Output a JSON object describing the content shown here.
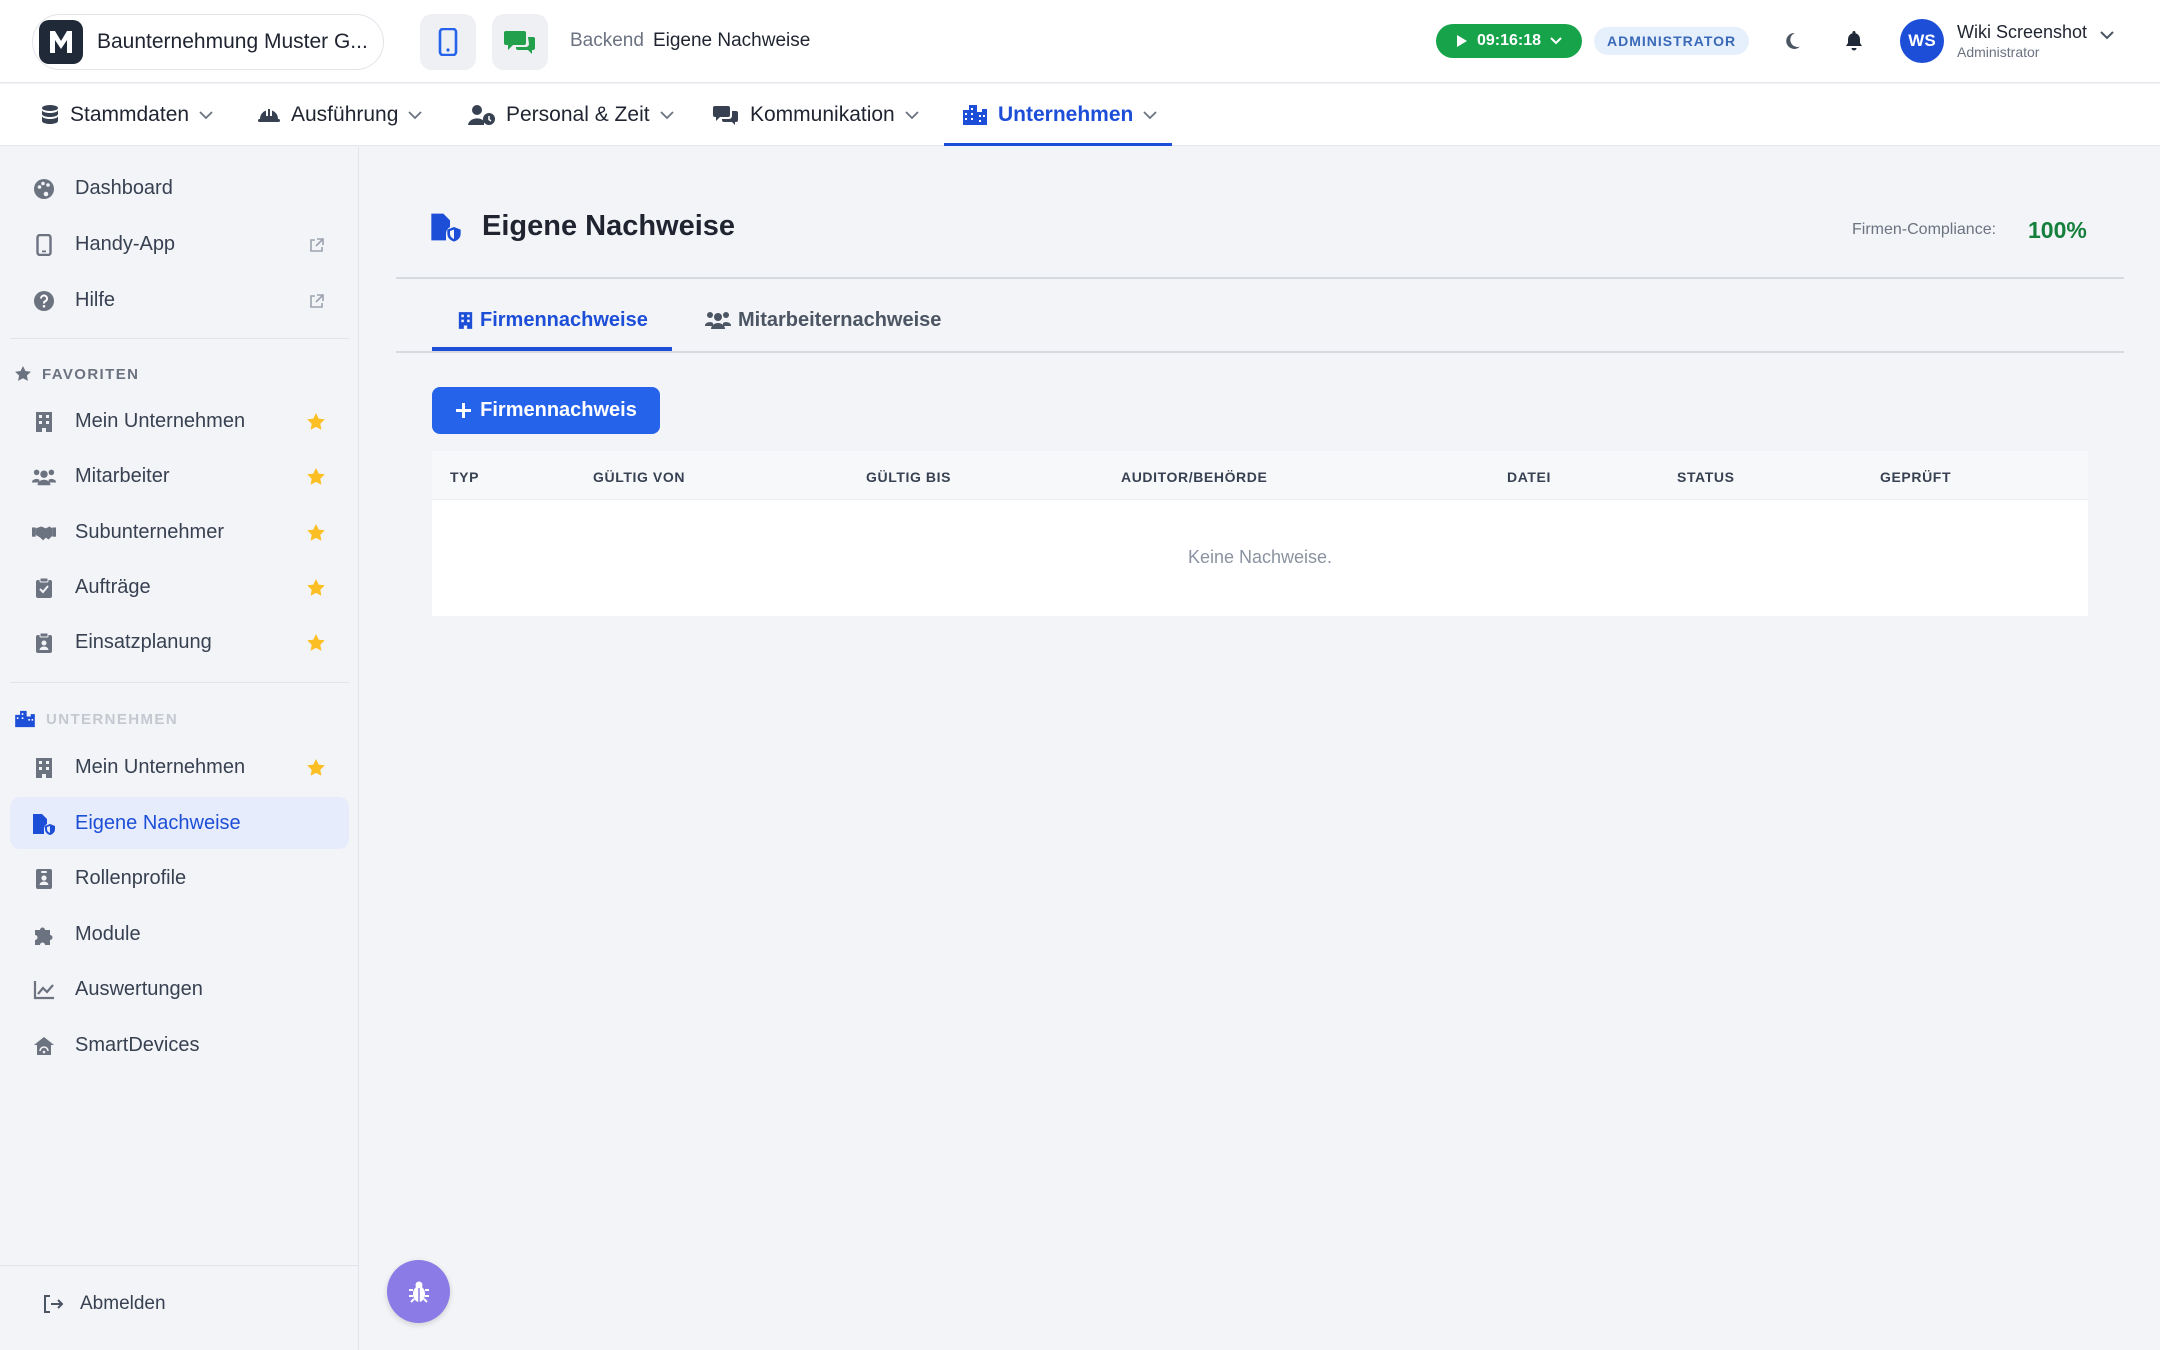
{
  "header": {
    "company_name": "Baunternehmung Muster G...",
    "logo_letter": "M",
    "breadcrumb": {
      "section": "Backend",
      "current": "Eigene Nachweise"
    },
    "timer": "09:16:18",
    "role_badge": "ADMINISTRATOR",
    "user": {
      "initials": "WS",
      "name": "Wiki Screenshot",
      "role": "Administrator"
    }
  },
  "mainnav": {
    "items": [
      {
        "label": "Stammdaten",
        "icon": "database-icon"
      },
      {
        "label": "Ausführung",
        "icon": "hardhat-icon"
      },
      {
        "label": "Personal & Zeit",
        "icon": "user-clock-icon"
      },
      {
        "label": "Kommunikation",
        "icon": "comments-icon"
      },
      {
        "label": "Unternehmen",
        "icon": "city-icon",
        "active": true
      }
    ]
  },
  "sidebar": {
    "top": [
      {
        "label": "Dashboard",
        "icon": "palette-icon"
      },
      {
        "label": "Handy-App",
        "icon": "mobile-icon",
        "external": true
      },
      {
        "label": "Hilfe",
        "icon": "question-circle-icon",
        "external": true
      }
    ],
    "favorites_title": "FAVORITEN",
    "favorites": [
      {
        "label": "Mein Unternehmen",
        "icon": "building-icon"
      },
      {
        "label": "Mitarbeiter",
        "icon": "users-icon"
      },
      {
        "label": "Subunternehmer",
        "icon": "handshake-icon"
      },
      {
        "label": "Aufträge",
        "icon": "clipboard-check-icon"
      },
      {
        "label": "Einsatzplanung",
        "icon": "clipboard-user-icon"
      }
    ],
    "company_title": "UNTERNEHMEN",
    "company": [
      {
        "label": "Mein Unternehmen",
        "icon": "building-icon",
        "starred": true
      },
      {
        "label": "Eigene Nachweise",
        "icon": "file-shield-icon",
        "active": true
      },
      {
        "label": "Rollenprofile",
        "icon": "id-badge-icon"
      },
      {
        "label": "Module",
        "icon": "puzzle-icon"
      },
      {
        "label": "Auswertungen",
        "icon": "chart-line-icon"
      },
      {
        "label": "SmartDevices",
        "icon": "smart-home-icon"
      }
    ],
    "logout": "Abmelden"
  },
  "page": {
    "title": "Eigene Nachweise",
    "compliance_label": "Firmen-Compliance:",
    "compliance_value": "100%",
    "tabs": [
      {
        "label": "Firmennachweise",
        "active": true
      },
      {
        "label": "Mitarbeiternachweise"
      }
    ],
    "add_button": "Firmennachweis",
    "table": {
      "columns": [
        "TYP",
        "GÜLTIG VON",
        "GÜLTIG BIS",
        "AUDITOR/BEHÖRDE",
        "DATEI",
        "STATUS",
        "GEPRÜFT"
      ],
      "empty": "Keine Nachweise."
    }
  },
  "colors": {
    "accent": "#1d4ed8",
    "button": "#2563eb",
    "timer": "#16a34a",
    "compliance": "#15803d",
    "star": "#fbbf24",
    "bug_button": "#8b7be6"
  }
}
